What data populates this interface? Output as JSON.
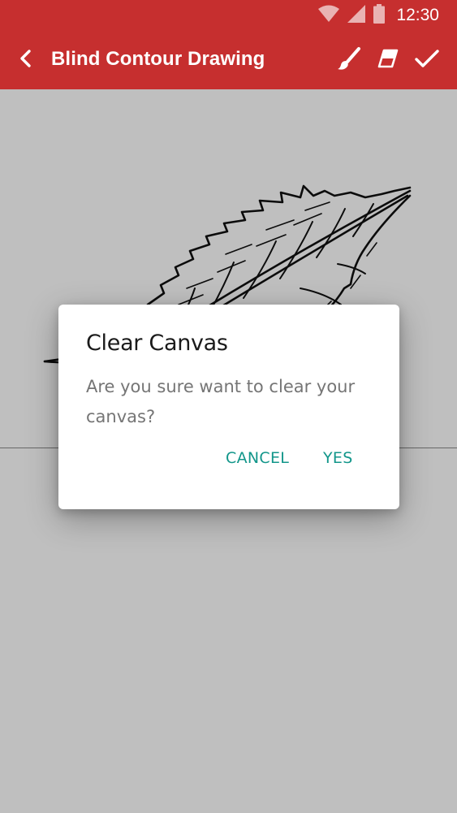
{
  "status_bar": {
    "time": "12:30"
  },
  "app_bar": {
    "title": "Blind Contour Drawing"
  },
  "dialog": {
    "title": "Clear Canvas",
    "message": "Are you sure want to clear your canvas?",
    "cancel_label": "CANCEL",
    "confirm_label": "YES"
  },
  "colors": {
    "app_bar": "#c62f2f",
    "accent": "#12968a",
    "scrim": "rgba(0,0,0,0.25)"
  },
  "icons": {
    "back": "chevron-left-icon",
    "brush": "brush-icon",
    "eraser": "eraser-icon",
    "done": "check-icon",
    "wifi": "wifi-icon",
    "signal": "signal-icon",
    "battery": "battery-icon"
  }
}
